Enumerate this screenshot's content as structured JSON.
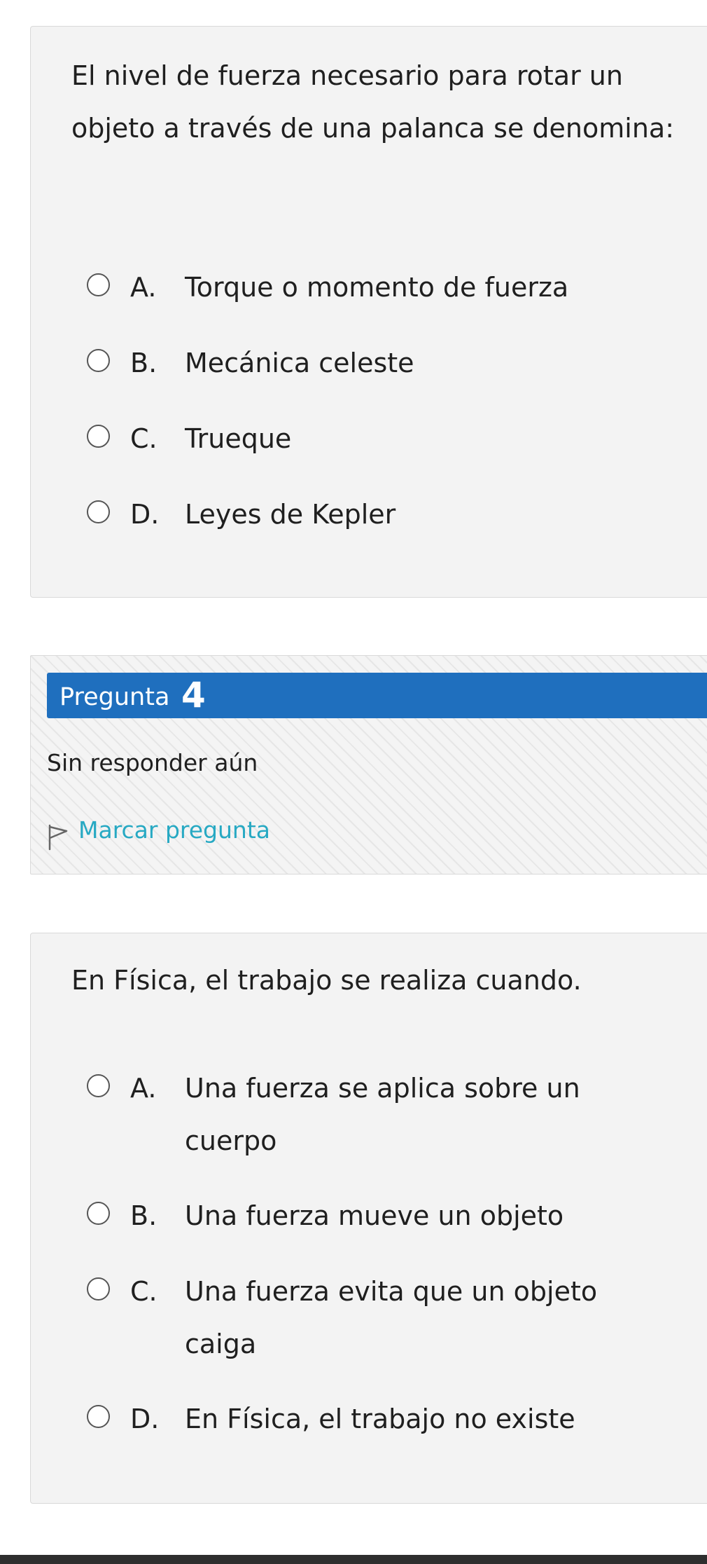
{
  "question3": {
    "prompt": "El nivel de fuerza necesario para rotar un objeto a través de una palanca se denomina:",
    "answers": [
      {
        "letter": "A.",
        "text": "Torque o momento de fuerza"
      },
      {
        "letter": "B.",
        "text": "Mecánica celeste"
      },
      {
        "letter": "C.",
        "text": "Trueque"
      },
      {
        "letter": "D.",
        "text": "Leyes de Kepler"
      }
    ]
  },
  "question4_info": {
    "label": "Pregunta",
    "number": "4",
    "state": "Sin responder aún",
    "flag_label": "Marcar pregunta",
    "flag_icon": "flag-outline-icon",
    "header_color": "#1f6fbe",
    "link_color": "#27a9c3"
  },
  "question4": {
    "prompt": "En Física, el trabajo se realiza cuando.",
    "answers": [
      {
        "letter": "A.",
        "text": "Una fuerza se aplica sobre un cuerpo"
      },
      {
        "letter": "B.",
        "text": "Una fuerza mueve un objeto"
      },
      {
        "letter": "C.",
        "text": "Una fuerza evita que un objeto caiga"
      },
      {
        "letter": "D.",
        "text": "En Física, el trabajo no existe"
      }
    ]
  }
}
